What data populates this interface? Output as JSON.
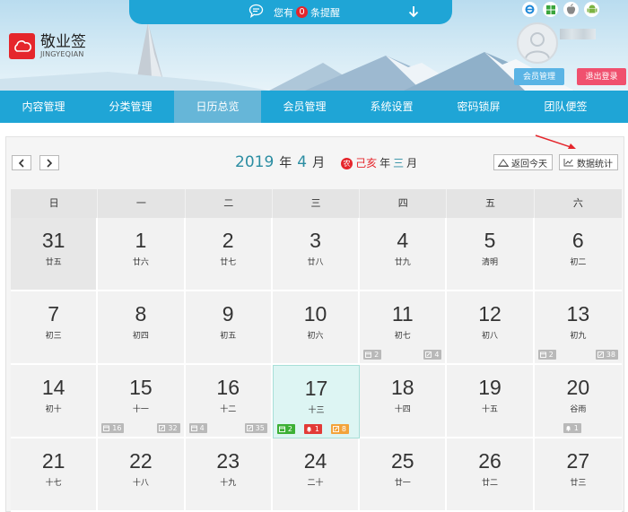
{
  "header": {
    "logo_title": "敬业签",
    "logo_sub": "JINGYEQIAN",
    "notice_prefix": "您有",
    "notice_count": "0",
    "notice_suffix": "条提醒",
    "member_btn": "会员管理",
    "logout_btn": "退出登录",
    "os_icons": [
      "ie-icon",
      "windows-icon",
      "apple-icon",
      "android-icon"
    ]
  },
  "nav": [
    "内容管理",
    "分类管理",
    "日历总览",
    "会员管理",
    "系统设置",
    "密码锁屏",
    "团队便签"
  ],
  "calendar": {
    "year": "2019",
    "year_unit": "年",
    "month": "4",
    "month_unit": "月",
    "lunar_badge": "农",
    "lunar_year": "己亥",
    "lunar_year_unit": "年",
    "lunar_month": "三",
    "lunar_month_unit": "月",
    "today_btn": "返回今天",
    "stats_btn": "数据统计",
    "weekdays": [
      "日",
      "一",
      "二",
      "三",
      "四",
      "五",
      "六"
    ],
    "rows": [
      [
        {
          "day": "31",
          "lunar": "廿五",
          "other": true
        },
        {
          "day": "1",
          "lunar": "廿六"
        },
        {
          "day": "2",
          "lunar": "廿七"
        },
        {
          "day": "3",
          "lunar": "廿八"
        },
        {
          "day": "4",
          "lunar": "廿九"
        },
        {
          "day": "5",
          "lunar": "清明"
        },
        {
          "day": "6",
          "lunar": "初二"
        }
      ],
      [
        {
          "day": "7",
          "lunar": "初三"
        },
        {
          "day": "8",
          "lunar": "初四"
        },
        {
          "day": "9",
          "lunar": "初五"
        },
        {
          "day": "10",
          "lunar": "初六"
        },
        {
          "day": "11",
          "lunar": "初七",
          "badges": [
            {
              "type": "calendar",
              "color": "grey",
              "count": "2",
              "pos": "left"
            },
            {
              "type": "note",
              "color": "grey",
              "count": "4",
              "pos": "right"
            }
          ]
        },
        {
          "day": "12",
          "lunar": "初八"
        },
        {
          "day": "13",
          "lunar": "初九",
          "badges": [
            {
              "type": "calendar",
              "color": "grey",
              "count": "2",
              "pos": "left"
            },
            {
              "type": "note",
              "color": "grey",
              "count": "38",
              "pos": "right"
            }
          ]
        }
      ],
      [
        {
          "day": "14",
          "lunar": "初十"
        },
        {
          "day": "15",
          "lunar": "十一",
          "badges": [
            {
              "type": "calendar",
              "color": "grey",
              "count": "16",
              "pos": "left"
            },
            {
              "type": "note",
              "color": "grey",
              "count": "32",
              "pos": "right"
            }
          ]
        },
        {
          "day": "16",
          "lunar": "十二",
          "badges": [
            {
              "type": "calendar",
              "color": "grey",
              "count": "4",
              "pos": "left"
            },
            {
              "type": "note",
              "color": "grey",
              "count": "35",
              "pos": "right"
            }
          ]
        },
        {
          "day": "17",
          "lunar": "十三",
          "today": true,
          "badges": [
            {
              "type": "calendar",
              "color": "green",
              "count": "2",
              "pos": "b1"
            },
            {
              "type": "bell",
              "color": "red",
              "count": "1",
              "pos": "b2"
            },
            {
              "type": "note",
              "color": "orange",
              "count": "8",
              "pos": "b3"
            }
          ]
        },
        {
          "day": "18",
          "lunar": "十四"
        },
        {
          "day": "19",
          "lunar": "十五"
        },
        {
          "day": "20",
          "lunar": "谷雨",
          "badges": [
            {
              "type": "bell",
              "color": "grey",
              "count": "1",
              "pos": "center"
            }
          ]
        }
      ],
      [
        {
          "day": "21",
          "lunar": "十七"
        },
        {
          "day": "22",
          "lunar": "十八"
        },
        {
          "day": "23",
          "lunar": "十九"
        },
        {
          "day": "24",
          "lunar": "二十"
        },
        {
          "day": "25",
          "lunar": "廿一"
        },
        {
          "day": "26",
          "lunar": "廿二"
        },
        {
          "day": "27",
          "lunar": "廿三"
        }
      ]
    ]
  }
}
